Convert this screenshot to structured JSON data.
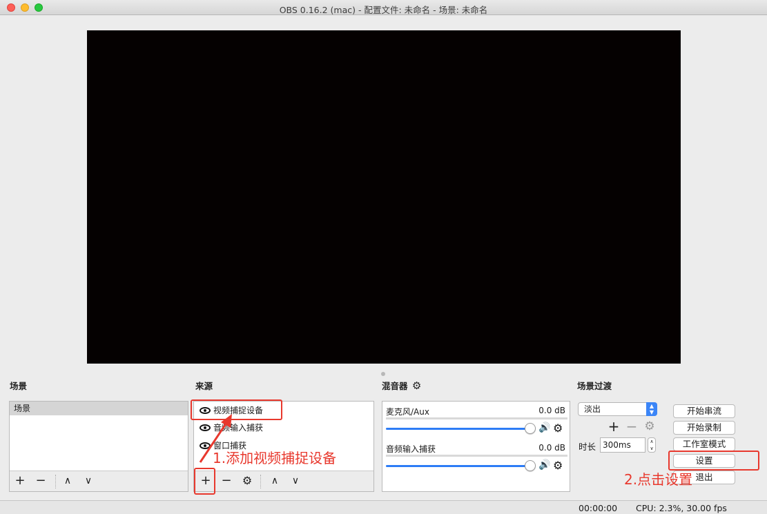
{
  "window": {
    "title": "OBS 0.16.2 (mac) - 配置文件: 未命名 - 场景: 未命名"
  },
  "docks": {
    "scenes": {
      "title": "场景",
      "items": [
        "场景"
      ]
    },
    "sources": {
      "title": "来源",
      "items": [
        "视频捕捉设备",
        "音频输入捕获",
        "窗口捕获"
      ]
    },
    "mixer": {
      "title": "混音器",
      "channels": [
        {
          "name": "麦克风/Aux",
          "level": "0.0 dB",
          "volume": 1.0
        },
        {
          "name": "音频输入捕获",
          "level": "0.0 dB",
          "volume": 1.0
        }
      ]
    },
    "transitions": {
      "title": "场景过渡",
      "selected": "淡出",
      "duration_label": "时长",
      "duration_value": "300ms"
    }
  },
  "controls": {
    "start_streaming": "开始串流",
    "start_recording": "开始录制",
    "studio_mode": "工作室模式",
    "settings": "设置",
    "exit": "退出"
  },
  "status": {
    "time": "00:00:00",
    "cpu": "CPU: 2.3%, 30.00 fps"
  },
  "annotations": {
    "step1": "1.添加视频捕捉设备",
    "step2": "2.点击设置"
  },
  "colors": {
    "accent": "#2d7cf6",
    "annotation": "#e8382d",
    "preview_bg": "#050101"
  }
}
